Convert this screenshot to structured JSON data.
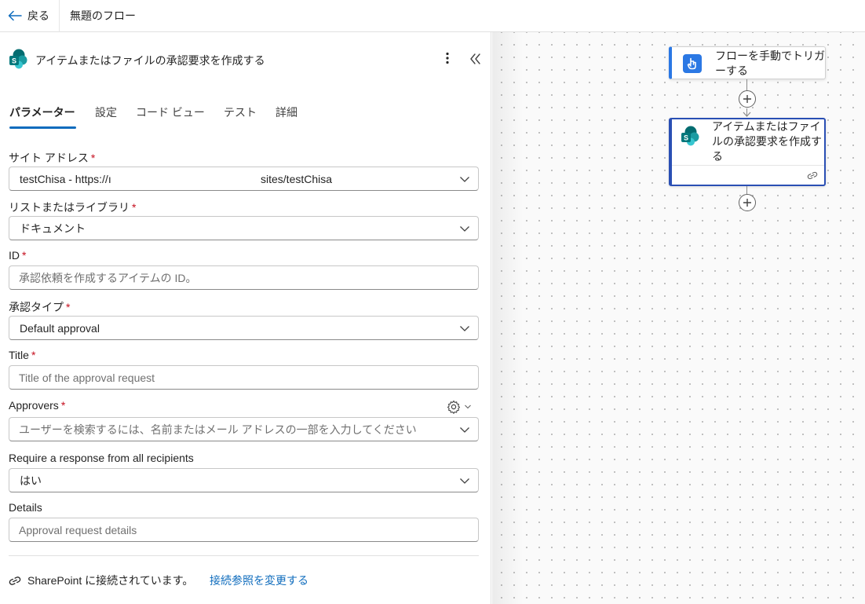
{
  "topbar": {
    "back_label": "戻る",
    "flow_title": "無題のフロー"
  },
  "panel": {
    "title": "アイテムまたはファイルの承認要求を作成する",
    "tabs": [
      {
        "label": "パラメーター",
        "active": true
      },
      {
        "label": "設定"
      },
      {
        "label": "コード ビュー"
      },
      {
        "label": "テスト"
      },
      {
        "label": "詳細"
      }
    ],
    "fields": {
      "site": {
        "label": "サイト アドレス",
        "required": "*",
        "value_start": "testChisa - https://ı",
        "value_end": "sites/testChisa"
      },
      "list": {
        "label": "リストまたはライブラリ",
        "required": "*",
        "value": "ドキュメント"
      },
      "id": {
        "label": "ID",
        "required": "*",
        "placeholder": "承認依頼を作成するアイテムの ID。"
      },
      "approval_type": {
        "label": "承認タイプ",
        "required": "*",
        "value": "Default approval"
      },
      "title": {
        "label": "Title",
        "required": "*",
        "placeholder": "Title of the approval request"
      },
      "approvers": {
        "label": "Approvers",
        "required": "*",
        "placeholder": "ユーザーを検索するには、名前またはメール アドレスの一部を入力してください"
      },
      "require_all": {
        "label": "Require a response from all recipients",
        "value": "はい"
      },
      "details": {
        "label": "Details",
        "placeholder": "Approval request details"
      }
    },
    "connection": {
      "text": "SharePoint に接続されています。",
      "change_link": "接続参照を変更する"
    }
  },
  "canvas": {
    "trigger_card": {
      "label": "フローを手動でトリガーする"
    },
    "action_card": {
      "label": "アイテムまたはファイルの承認要求を作成する"
    }
  },
  "colors": {
    "accent": "#0f6cbd",
    "required": "#c50f1f",
    "trigger_blue": "#2b78e4",
    "selected_border": "#2a4fb4"
  }
}
